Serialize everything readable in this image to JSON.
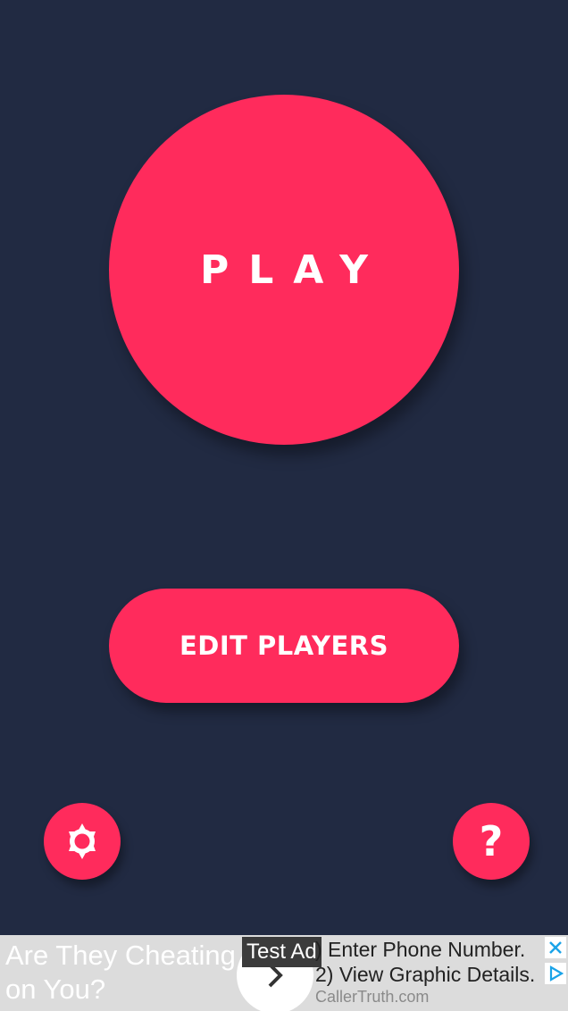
{
  "main": {
    "play_label": "PLAY",
    "edit_players_label": "EDIT PLAYERS"
  },
  "icons": {
    "settings": "gear-icon",
    "help": "question-icon",
    "help_glyph": "?"
  },
  "ad": {
    "headline": "Are They Cheating on You?",
    "tag": "Test Ad",
    "line1": ") Enter Phone Number.",
    "line2": "2) View Graphic Details.",
    "url": "CallerTruth.com"
  },
  "colors": {
    "background": "#212a42",
    "accent": "#ff2b5c",
    "ad_background": "#dcdcdc",
    "ad_icon": "#1aa3e8"
  }
}
